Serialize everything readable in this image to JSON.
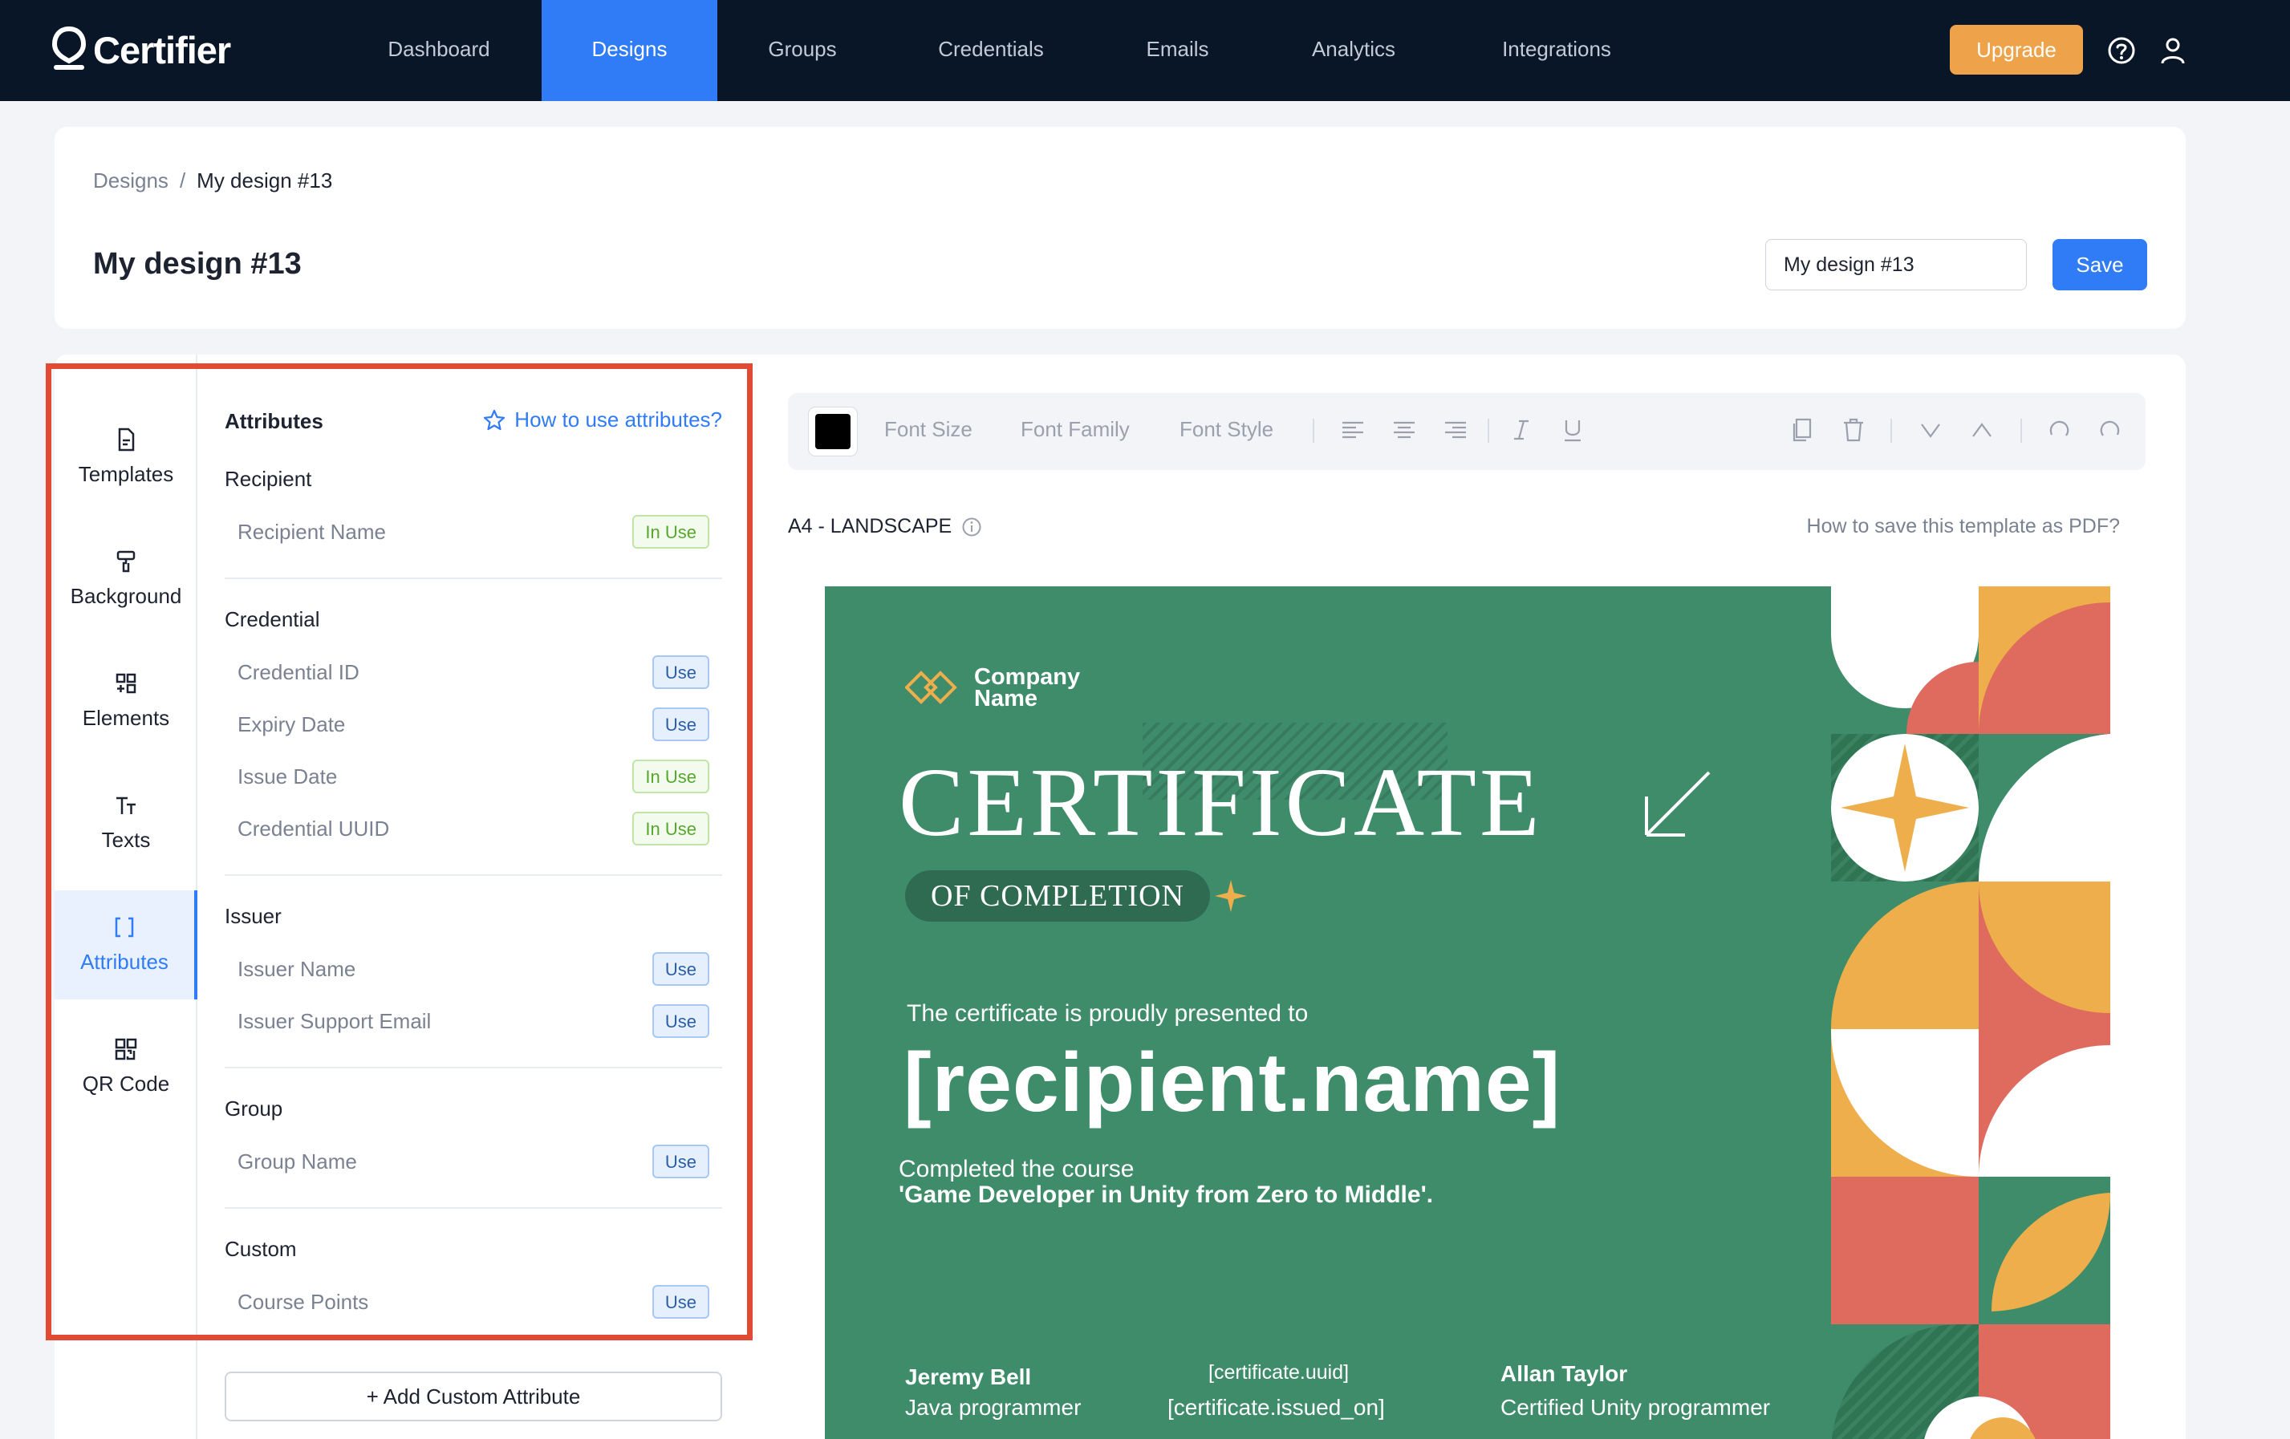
{
  "app": {
    "logo_text": "Certifier"
  },
  "nav": {
    "items": [
      {
        "label": "Dashboard"
      },
      {
        "label": "Designs"
      },
      {
        "label": "Groups"
      },
      {
        "label": "Credentials"
      },
      {
        "label": "Emails"
      },
      {
        "label": "Analytics"
      },
      {
        "label": "Integrations"
      }
    ],
    "active": "Designs",
    "upgrade_label": "Upgrade"
  },
  "header": {
    "breadcrumb": {
      "root": "Designs",
      "separator": "/",
      "current": "My design #13"
    },
    "title": "My design #13",
    "name_input_value": "My design #13",
    "save_label": "Save"
  },
  "sidebar": {
    "tabs": [
      {
        "label": "Templates",
        "icon": "file-icon"
      },
      {
        "label": "Background",
        "icon": "paint-roller-icon"
      },
      {
        "label": "Elements",
        "icon": "elements-icon"
      },
      {
        "label": "Texts",
        "icon": "text-icon"
      },
      {
        "label": "Attributes",
        "icon": "brackets-icon"
      },
      {
        "label": "QR Code",
        "icon": "qr-code-icon"
      }
    ],
    "active": "Attributes"
  },
  "attributes": {
    "heading": "Attributes",
    "help_link": "How to use attributes?",
    "groups": [
      {
        "title": "Recipient",
        "items": [
          {
            "name": "Recipient Name",
            "status": "In Use"
          }
        ]
      },
      {
        "title": "Credential",
        "items": [
          {
            "name": "Credential ID",
            "status": "Use"
          },
          {
            "name": "Expiry Date",
            "status": "Use"
          },
          {
            "name": "Issue Date",
            "status": "In Use"
          },
          {
            "name": "Credential UUID",
            "status": "In Use"
          }
        ]
      },
      {
        "title": "Issuer",
        "items": [
          {
            "name": "Issuer Name",
            "status": "Use"
          },
          {
            "name": "Issuer Support Email",
            "status": "Use"
          }
        ]
      },
      {
        "title": "Group",
        "items": [
          {
            "name": "Group Name",
            "status": "Use"
          }
        ]
      },
      {
        "title": "Custom",
        "items": [
          {
            "name": "Course Points",
            "status": "Use"
          }
        ]
      }
    ],
    "add_custom_label": "+ Add Custom Attribute"
  },
  "editor": {
    "toolbar": {
      "color": "#000000",
      "font_size": "Font Size",
      "font_family": "Font Family",
      "font_style": "Font Style"
    },
    "page_size": "A4 - LANDSCAPE",
    "save_pdf_link": "How to save this template as PDF?"
  },
  "certificate": {
    "company": "Company Name",
    "title": "CERTIFICATE",
    "subtitle": "OF COMPLETION",
    "presented": "The certificate is proudly presented to",
    "recipient": "[recipient.name]",
    "course_line1": "Completed the course",
    "course_line2": "'Game Developer in Unity from Zero to Middle'.",
    "signer1_name": "Jeremy Bell",
    "signer1_role": "Java programmer",
    "uuid": "[certificate.uuid]",
    "issued_on": "[certificate.issued_on]",
    "signer2_name": "Allan Taylor",
    "signer2_role": "Certified Unity programmer"
  },
  "colors": {
    "nav_bg": "#091628",
    "accent": "#2f7cf6",
    "upgrade": "#eea34a",
    "certificate_green": "#3f8c6b",
    "highlight": "#e24a33"
  }
}
